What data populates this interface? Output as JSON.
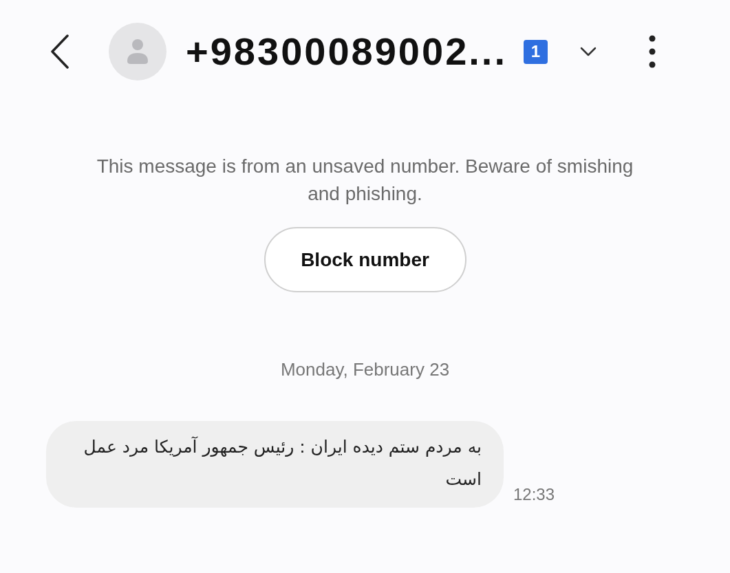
{
  "header": {
    "title": "+98300089002...",
    "sim_badge": "1"
  },
  "notice": {
    "text": "This message is from an unsaved number. Beware of smishing and phishing.",
    "button": "Block number"
  },
  "date_divider": "Monday, February 23",
  "messages": [
    {
      "kind": "received",
      "text": "به مردم ستم دیده ایران : رئیس جمهور آمریکا مرد عمل است",
      "time": "12:33"
    }
  ]
}
